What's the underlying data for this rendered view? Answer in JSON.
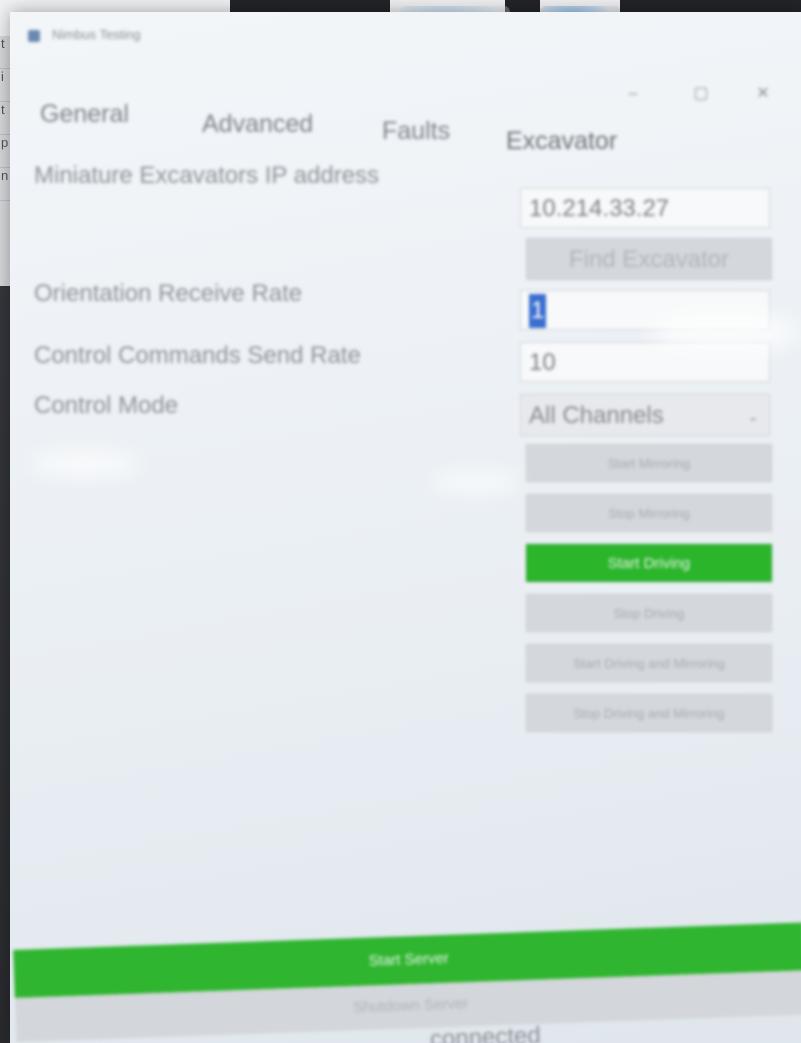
{
  "window": {
    "title": "Nimbus Testing",
    "minimize_icon": "minimize-icon",
    "maximize_icon": "maximize-icon",
    "close_icon": "close-icon"
  },
  "tabs": [
    {
      "label": "General"
    },
    {
      "label": "Advanced"
    },
    {
      "label": "Faults"
    },
    {
      "label": "Excavator",
      "active": true
    }
  ],
  "excavator": {
    "ip_label": "Miniature Excavators IP address",
    "ip_value": "10.214.33.27",
    "find_button": "Find Excavator",
    "orientation_label": "Orientation Receive Rate",
    "orientation_value": "1",
    "commands_label": "Control Commands Send Rate",
    "commands_value": "10",
    "mode_label": "Control Mode",
    "mode_value": "All Channels",
    "buttons": {
      "start_mirroring": "Start Mirroring",
      "stop_mirroring": "Stop Mirroring",
      "start_driving": "Start Driving",
      "stop_driving": "Stop Driving",
      "start_driving_mirroring": "Start Driving and Mirroring",
      "stop_driving_mirroring": "Stop Driving and Mirroring"
    }
  },
  "footer": {
    "start_server": "Start Server",
    "shutdown_server": "Shutdown Server",
    "status": "connected"
  },
  "colors": {
    "accent_green": "#2bb52b",
    "disabled_gray": "#d4d7db",
    "selection_blue": "#3a6ecf"
  }
}
